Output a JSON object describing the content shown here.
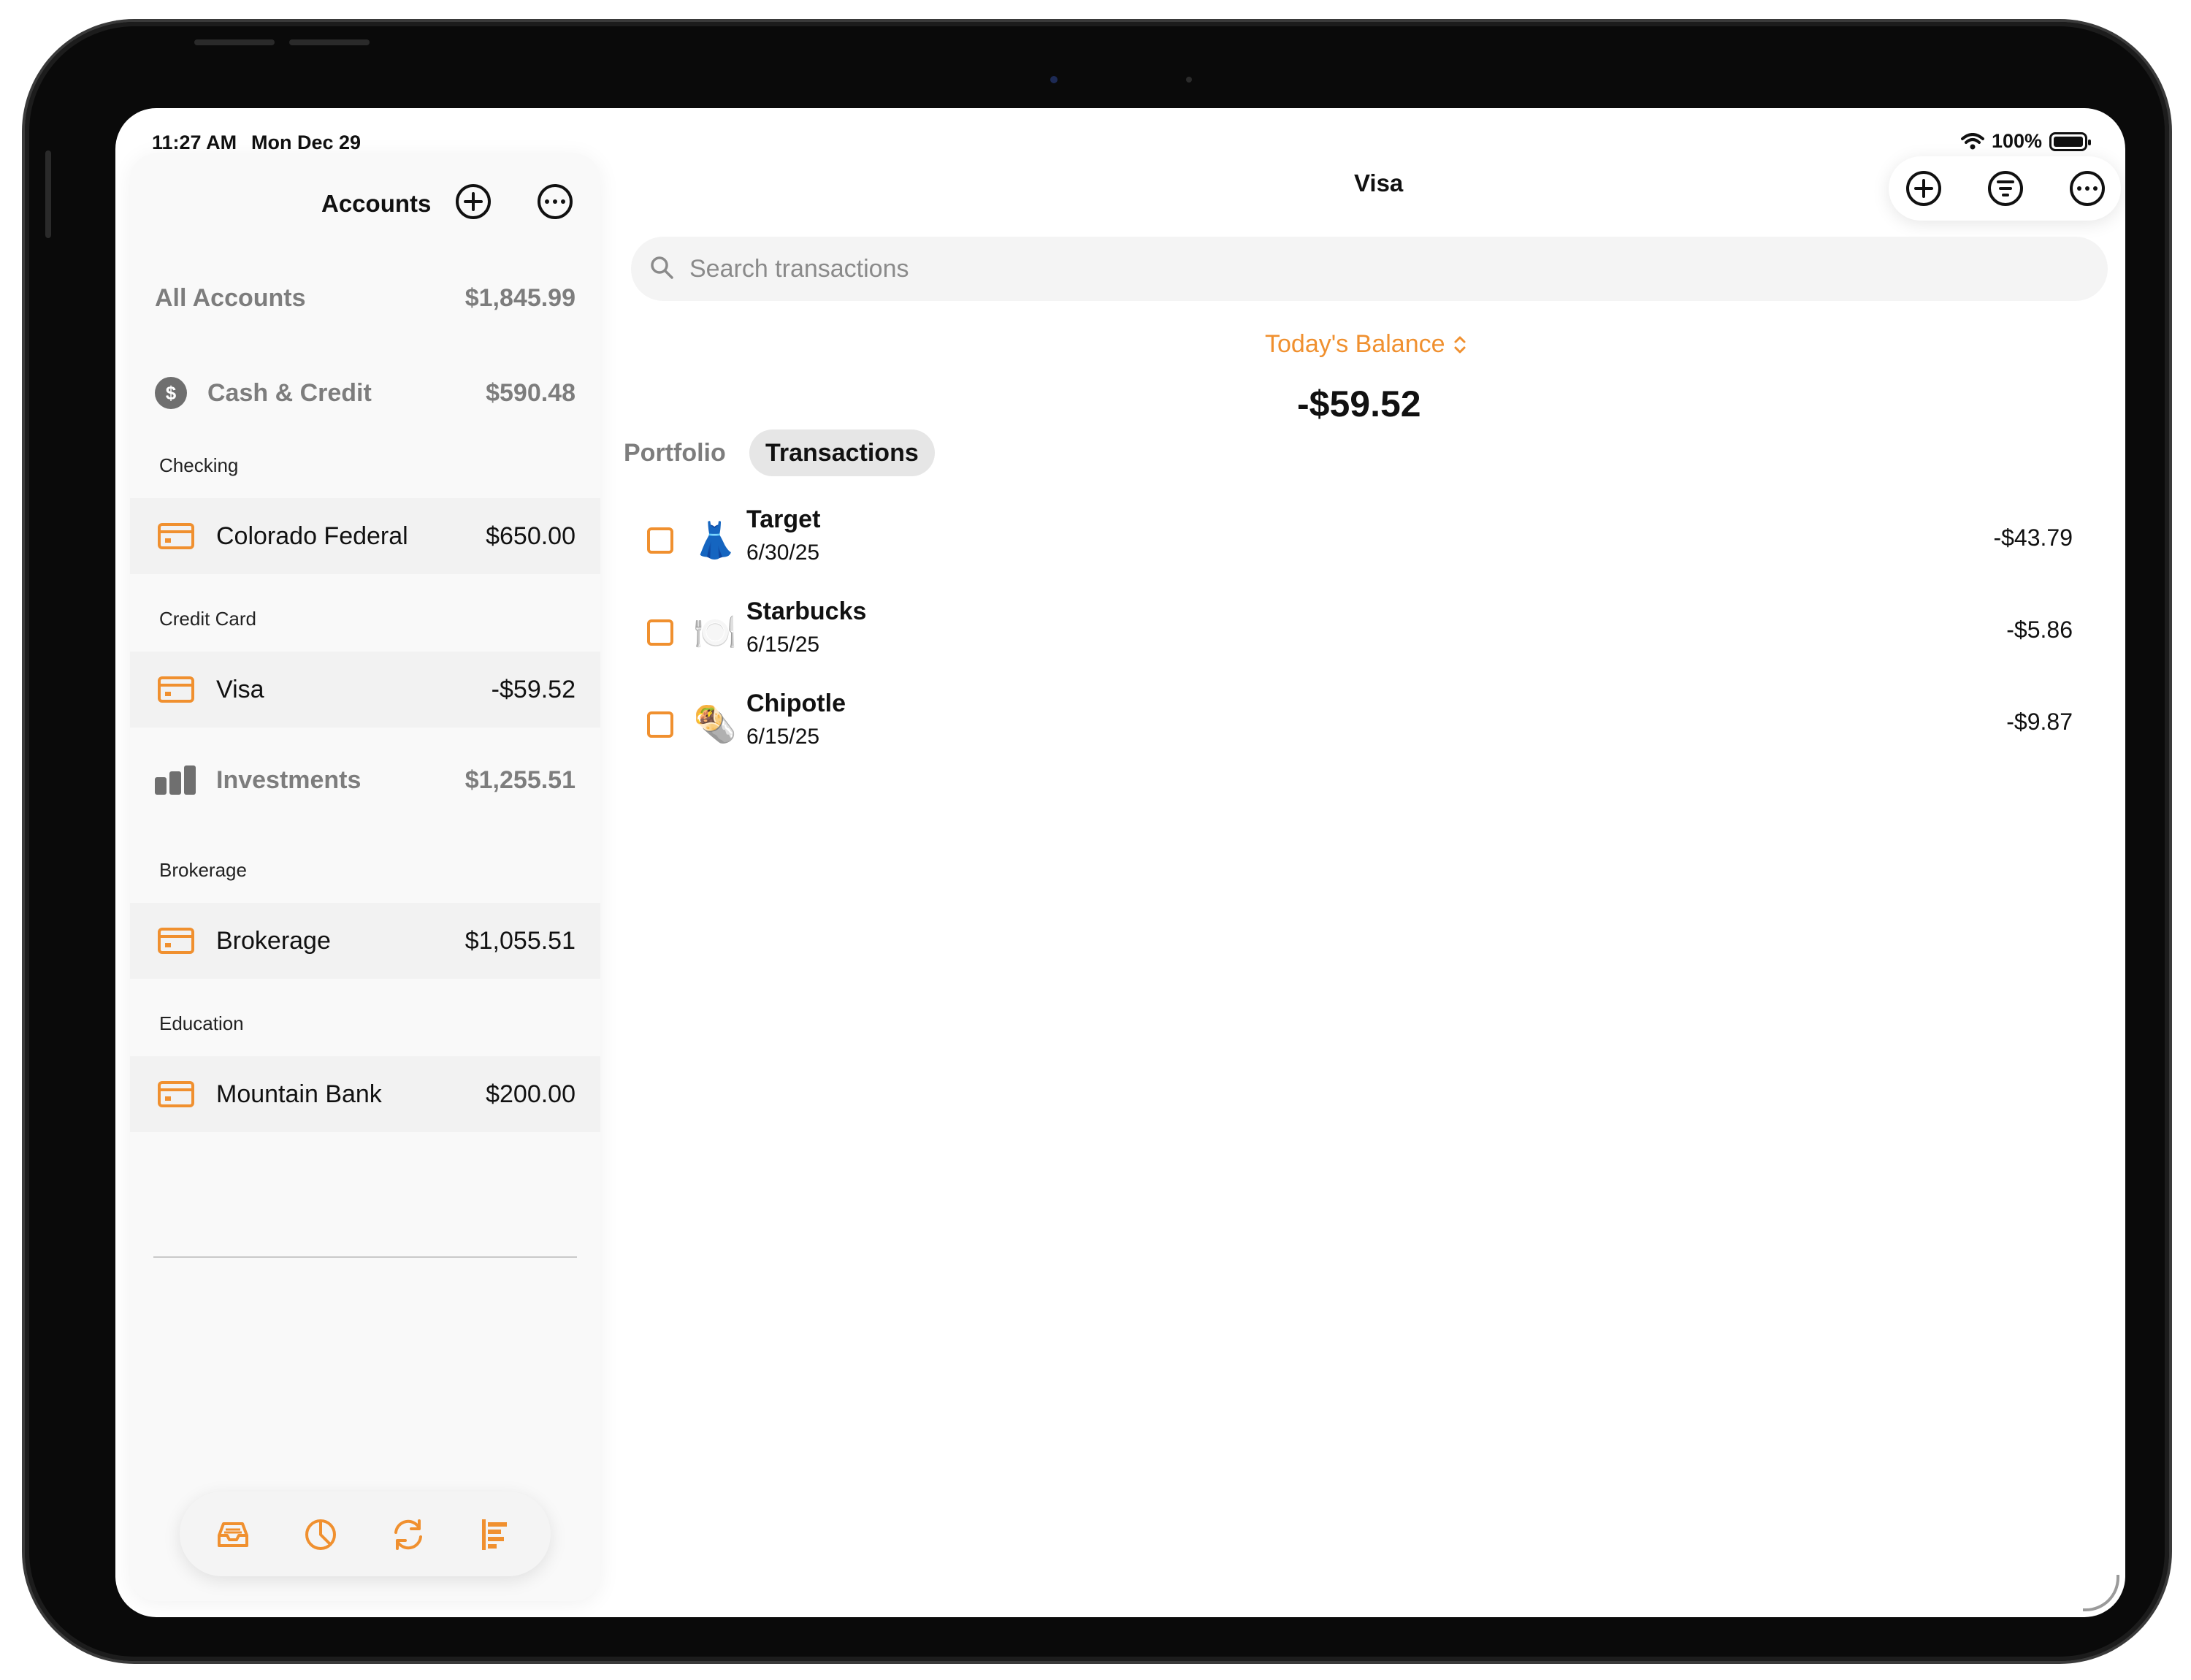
{
  "status_bar": {
    "time": "11:27 AM",
    "date": "Mon Dec 29",
    "battery": "100%"
  },
  "sidebar": {
    "title": "Accounts",
    "all_accounts": {
      "label": "All Accounts",
      "amount": "$1,845.99"
    },
    "groups": [
      {
        "name": "Cash & Credit",
        "amount": "$590.48",
        "icon": "dollar-circle-icon",
        "sections": [
          {
            "label": "Checking",
            "accounts": [
              {
                "name": "Colorado Federal",
                "amount": "$650.00",
                "icon": "credit-card-icon"
              }
            ]
          },
          {
            "label": "Credit Card",
            "accounts": [
              {
                "name": "Visa",
                "amount": "-$59.52",
                "icon": "credit-card-icon",
                "selected": true
              }
            ]
          }
        ]
      },
      {
        "name": "Investments",
        "amount": "$1,255.51",
        "icon": "bar-chart-icon",
        "sections": [
          {
            "label": "Brokerage",
            "accounts": [
              {
                "name": "Brokerage",
                "amount": "$1,055.51",
                "icon": "credit-card-icon"
              }
            ]
          },
          {
            "label": "Education",
            "accounts": [
              {
                "name": "Mountain Bank",
                "amount": "$200.00",
                "icon": "credit-card-icon"
              }
            ]
          }
        ]
      }
    ],
    "tabbar": [
      "inbox-icon",
      "pie-chart-icon",
      "sync-icon",
      "report-icon"
    ]
  },
  "main": {
    "title": "Visa",
    "search": {
      "placeholder": "Search transactions",
      "value": ""
    },
    "balance": {
      "label": "Today's Balance",
      "value": "-$59.52"
    },
    "segments": {
      "portfolio": "Portfolio",
      "transactions": "Transactions",
      "selected": "Transactions"
    },
    "transactions": [
      {
        "name": "Target",
        "date": "6/30/25",
        "amount": "-$43.79",
        "emoji": "👗"
      },
      {
        "name": "Starbucks",
        "date": "6/15/25",
        "amount": "-$5.86",
        "emoji": "🍽️"
      },
      {
        "name": "Chipotle",
        "date": "6/15/25",
        "amount": "-$9.87",
        "emoji": "🌯"
      }
    ]
  },
  "colors": {
    "accent": "#f0902f",
    "secondary_text": "#7d7d7d",
    "sidebar_bg": "#f9f9f9"
  }
}
